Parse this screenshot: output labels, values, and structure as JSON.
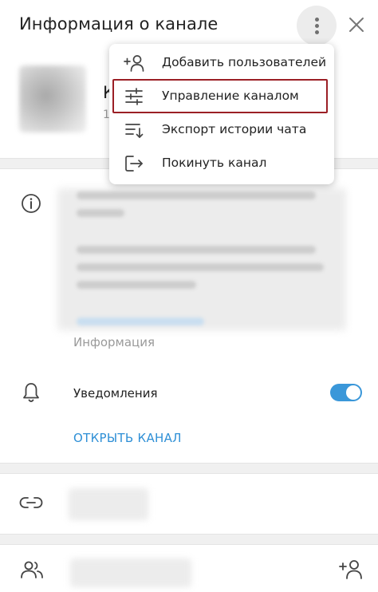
{
  "header": {
    "title": "Информация о канале"
  },
  "channel": {
    "name_fragment": "К",
    "subtitle_fragment": "1"
  },
  "info": {
    "caption": "Информация"
  },
  "notifications": {
    "label": "Уведомления",
    "enabled": true
  },
  "open_channel": {
    "label": "ОТКРЫТЬ КАНАЛ"
  },
  "menu": {
    "items": [
      {
        "label": "Добавить пользователей",
        "icon": "add-user-icon"
      },
      {
        "label": "Управление каналом",
        "icon": "sliders-icon"
      },
      {
        "label": "Экспорт истории чата",
        "icon": "export-history-icon"
      },
      {
        "label": "Покинуть канал",
        "icon": "leave-icon"
      }
    ],
    "highlight_color": "#9b1f25"
  },
  "colors": {
    "accent": "#2e8fd6",
    "toggle_on": "#3a97d9"
  }
}
